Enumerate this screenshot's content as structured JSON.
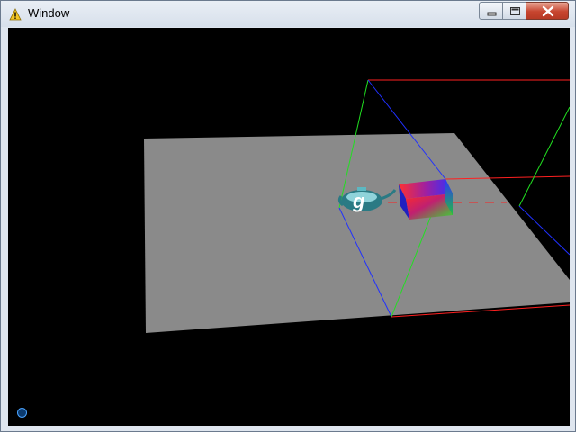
{
  "window": {
    "title": "Window",
    "icon": "warning-icon"
  },
  "title_controls": {
    "minimize_icon": "minimize-icon",
    "maximize_icon": "maximize-icon",
    "close_icon": "close-icon"
  },
  "scene": {
    "background_color": "#000000",
    "plane_color": "#8a8a8a",
    "axis_colors": {
      "x": "#ff2020",
      "y": "#20e020",
      "z": "#2030ff"
    },
    "teapot_label": "g",
    "status_indicator_color": "#4aa3ff"
  }
}
